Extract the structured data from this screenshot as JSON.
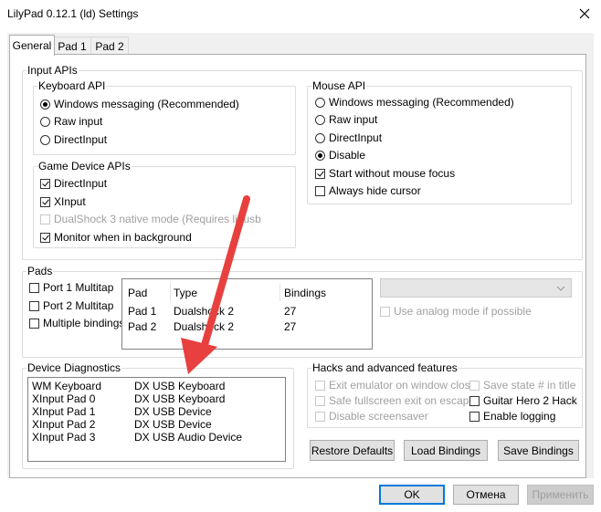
{
  "window": {
    "title": "LilyPad 0.12.1 (ld) Settings"
  },
  "tabs": [
    {
      "label": "General"
    },
    {
      "label": "Pad 1"
    },
    {
      "label": "Pad 2"
    }
  ],
  "input_apis": {
    "title": "Input APIs",
    "keyboard_api": {
      "title": "Keyboard API",
      "options": [
        {
          "label": "Windows messaging (Recommended)",
          "selected": true
        },
        {
          "label": "Raw input",
          "selected": false
        },
        {
          "label": "DirectInput",
          "selected": false
        }
      ]
    },
    "game_device_apis": {
      "title": "Game Device APIs",
      "options": [
        {
          "label": "DirectInput",
          "checked": true,
          "enabled": true
        },
        {
          "label": "XInput",
          "checked": true,
          "enabled": true
        },
        {
          "label": "DualShock 3 native mode (Requires libusb",
          "checked": false,
          "enabled": false
        },
        {
          "label": "Monitor when in background",
          "checked": true,
          "enabled": true
        }
      ]
    },
    "mouse_api": {
      "title": "Mouse API",
      "options": [
        {
          "label": "Windows messaging (Recommended)",
          "selected": false
        },
        {
          "label": "Raw input",
          "selected": false
        },
        {
          "label": "DirectInput",
          "selected": false
        },
        {
          "label": "Disable",
          "selected": true
        }
      ],
      "extra": [
        {
          "label": "Start without mouse focus",
          "checked": true
        },
        {
          "label": "Always hide cursor",
          "checked": false
        }
      ]
    }
  },
  "pads": {
    "title": "Pads",
    "options": [
      {
        "label": "Port 1 Multitap",
        "checked": false
      },
      {
        "label": "Port 2 Multitap",
        "checked": false
      },
      {
        "label": "Multiple bindings",
        "checked": false
      }
    ],
    "table": {
      "headers": [
        "Pad",
        "Type",
        "Bindings"
      ],
      "rows": [
        [
          "Pad 1",
          "Dualshock 2",
          "27"
        ],
        [
          "Pad 2",
          "Dualshock 2",
          "27"
        ]
      ]
    },
    "analog_mode": {
      "label": "Use analog mode if possible",
      "checked": false,
      "enabled": false
    }
  },
  "device_diagnostics": {
    "title": "Device Diagnostics",
    "rows": [
      [
        "WM Keyboard",
        "DX USB Keyboard"
      ],
      [
        "XInput Pad 0",
        "DX USB Keyboard"
      ],
      [
        "XInput Pad 1",
        "DX USB Device"
      ],
      [
        "XInput Pad 2",
        "DX USB Device"
      ],
      [
        "XInput Pad 3",
        "DX USB Audio Device"
      ]
    ]
  },
  "hacks": {
    "title": "Hacks and advanced features",
    "left": [
      {
        "label": "Exit emulator on window close",
        "checked": false,
        "enabled": false
      },
      {
        "label": "Safe fullscreen exit on escape",
        "checked": false,
        "enabled": false
      },
      {
        "label": "Disable screensaver",
        "checked": false,
        "enabled": false
      }
    ],
    "right": [
      {
        "label": "Save state # in title",
        "checked": false,
        "enabled": false
      },
      {
        "label": "Guitar Hero 2 Hack",
        "checked": false,
        "enabled": true
      },
      {
        "label": "Enable logging",
        "checked": false,
        "enabled": true
      }
    ]
  },
  "buttons": {
    "restore_defaults": "Restore Defaults",
    "load_bindings": "Load Bindings",
    "save_bindings": "Save Bindings",
    "ok": "OK",
    "cancel": "Отмена",
    "apply": "Применить"
  },
  "colors": {
    "accent": "#0078d7",
    "annotation_arrow": "#e8403f"
  }
}
